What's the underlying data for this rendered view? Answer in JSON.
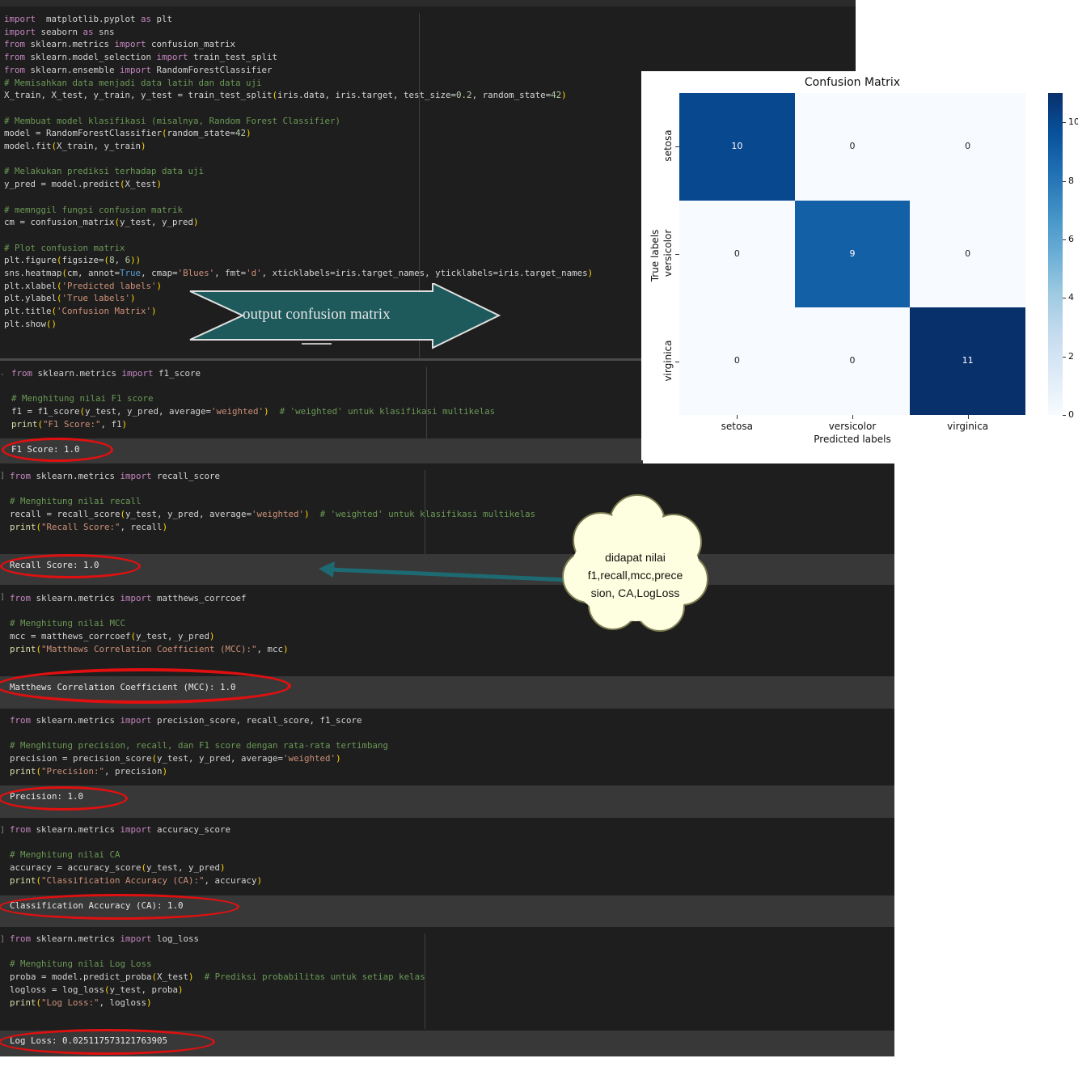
{
  "top_cell": {
    "lines": [
      [
        [
          "kw",
          "import"
        ],
        [
          "",
          "  matplotlib.pyplot "
        ],
        [
          "kw",
          "as"
        ],
        [
          "",
          " plt"
        ]
      ],
      [
        [
          "kw",
          "import"
        ],
        [
          "",
          " seaborn "
        ],
        [
          "kw",
          "as"
        ],
        [
          "",
          " sns"
        ]
      ],
      [
        [
          "kw",
          "from"
        ],
        [
          "",
          " sklearn.metrics "
        ],
        [
          "kw",
          "import"
        ],
        [
          "",
          " confusion_matrix"
        ]
      ],
      [
        [
          "kw",
          "from"
        ],
        [
          "",
          " sklearn.model_selection "
        ],
        [
          "kw",
          "import"
        ],
        [
          "",
          " train_test_split"
        ]
      ],
      [
        [
          "kw",
          "from"
        ],
        [
          "",
          " sklearn.ensemble "
        ],
        [
          "kw",
          "import"
        ],
        [
          "",
          " RandomForestClassifier"
        ]
      ],
      [
        [
          "cm",
          "# Memisahkan data menjadi data latih dan data uji"
        ]
      ],
      [
        [
          "",
          "X_train, X_test, y_train, y_test = train_test_split"
        ],
        [
          "pr",
          "("
        ],
        [
          "",
          "iris.data, iris.target, test_size="
        ],
        [
          "nm",
          "0.2"
        ],
        [
          "",
          ", random_state="
        ],
        [
          "nm",
          "42"
        ],
        [
          "pr",
          ")"
        ]
      ],
      [
        [
          "",
          ""
        ]
      ],
      [
        [
          "cm",
          "# Membuat model klasifikasi (misalnya, Random Forest Classifier)"
        ]
      ],
      [
        [
          "",
          "model = RandomForestClassifier"
        ],
        [
          "pr",
          "("
        ],
        [
          "",
          "random_state="
        ],
        [
          "nm",
          "42"
        ],
        [
          "pr",
          ")"
        ]
      ],
      [
        [
          "",
          "model.fit"
        ],
        [
          "pr",
          "("
        ],
        [
          "",
          "X_train, y_train"
        ],
        [
          "pr",
          ")"
        ]
      ],
      [
        [
          "",
          ""
        ]
      ],
      [
        [
          "cm",
          "# Melakukan prediksi terhadap data uji"
        ]
      ],
      [
        [
          "",
          "y_pred = model.predict"
        ],
        [
          "pr",
          "("
        ],
        [
          "",
          "X_test"
        ],
        [
          "pr",
          ")"
        ]
      ],
      [
        [
          "",
          ""
        ]
      ],
      [
        [
          "cm",
          "# memnggil fungsi confusion matrik"
        ]
      ],
      [
        [
          "",
          "cm = confusion_matrix"
        ],
        [
          "pr",
          "("
        ],
        [
          "",
          "y_test, y_pred"
        ],
        [
          "pr",
          ")"
        ]
      ],
      [
        [
          "",
          ""
        ]
      ],
      [
        [
          "cm",
          "# Plot confusion matrix"
        ]
      ],
      [
        [
          "",
          "plt.figure"
        ],
        [
          "pr",
          "("
        ],
        [
          "",
          "figsize="
        ],
        [
          "pr",
          "("
        ],
        [
          "nm",
          "8"
        ],
        [
          "",
          ", "
        ],
        [
          "nm",
          "6"
        ],
        [
          "pr",
          "))"
        ]
      ],
      [
        [
          "",
          "sns.heatmap"
        ],
        [
          "pr",
          "("
        ],
        [
          "",
          "cm, annot="
        ],
        [
          "bi",
          "True"
        ],
        [
          "",
          ", cmap="
        ],
        [
          "st",
          "'Blues'"
        ],
        [
          "",
          ", fmt="
        ],
        [
          "st",
          "'d'"
        ],
        [
          "",
          ", xticklabels=iris.target_names, yticklabels=iris.target_names"
        ],
        [
          "pr",
          ")"
        ]
      ],
      [
        [
          "",
          "plt.xlabel"
        ],
        [
          "pr",
          "("
        ],
        [
          "st",
          "'Predicted labels'"
        ],
        [
          "pr",
          ")"
        ]
      ],
      [
        [
          "",
          "plt.ylabel"
        ],
        [
          "pr",
          "("
        ],
        [
          "st",
          "'True labels'"
        ],
        [
          "pr",
          ")"
        ]
      ],
      [
        [
          "",
          "plt.title"
        ],
        [
          "pr",
          "("
        ],
        [
          "st",
          "'Confusion Matrix'"
        ],
        [
          "pr",
          ")"
        ]
      ],
      [
        [
          "",
          "plt.show"
        ],
        [
          "pr",
          "()"
        ]
      ]
    ]
  },
  "arrow_label": "output confusion matrix",
  "cells": [
    {
      "code": [
        [
          [
            "kw",
            "from"
          ],
          [
            "",
            " sklearn.metrics "
          ],
          [
            "kw",
            "import"
          ],
          [
            "",
            " f1_score"
          ]
        ],
        [
          [
            "",
            ""
          ]
        ],
        [
          [
            "cm",
            "# Menghitung nilai F1 score"
          ]
        ],
        [
          [
            "",
            "f1 = f1_score"
          ],
          [
            "pr",
            "("
          ],
          [
            "",
            "y_test, y_pred, average="
          ],
          [
            "st",
            "'weighted'"
          ],
          [
            "pr",
            ")"
          ],
          [
            "",
            "  "
          ],
          [
            "cm",
            "# 'weighted' untuk klasifikasi multikelas"
          ]
        ],
        [
          [
            "fn",
            "print"
          ],
          [
            "pr",
            "("
          ],
          [
            "st",
            "\"F1 Score:\""
          ],
          [
            "",
            ", f1"
          ],
          [
            "pr",
            ")"
          ]
        ]
      ],
      "output": "F1 Score: 1.0"
    },
    {
      "code": [
        [
          [
            "kw",
            "from"
          ],
          [
            "",
            " sklearn.metrics "
          ],
          [
            "kw",
            "import"
          ],
          [
            "",
            " recall_score"
          ]
        ],
        [
          [
            "",
            ""
          ]
        ],
        [
          [
            "cm",
            "# Menghitung nilai recall"
          ]
        ],
        [
          [
            "",
            "recall = recall_score"
          ],
          [
            "pr",
            "("
          ],
          [
            "",
            "y_test, y_pred, average="
          ],
          [
            "st",
            "'weighted'"
          ],
          [
            "pr",
            ")"
          ],
          [
            "",
            "  "
          ],
          [
            "cm",
            "# 'weighted' untuk klasifikasi multikelas"
          ]
        ],
        [
          [
            "fn",
            "print"
          ],
          [
            "pr",
            "("
          ],
          [
            "st",
            "\"Recall Score:\""
          ],
          [
            "",
            ", recall"
          ],
          [
            "pr",
            ")"
          ]
        ]
      ],
      "output": "Recall Score: 1.0"
    },
    {
      "code": [
        [
          [
            "kw",
            "from"
          ],
          [
            "",
            " sklearn.metrics "
          ],
          [
            "kw",
            "import"
          ],
          [
            "",
            " matthews_corrcoef"
          ]
        ],
        [
          [
            "",
            ""
          ]
        ],
        [
          [
            "cm",
            "# Menghitung nilai MCC"
          ]
        ],
        [
          [
            "",
            "mcc = matthews_corrcoef"
          ],
          [
            "pr",
            "("
          ],
          [
            "",
            "y_test, y_pred"
          ],
          [
            "pr",
            ")"
          ]
        ],
        [
          [
            "fn",
            "print"
          ],
          [
            "pr",
            "("
          ],
          [
            "st",
            "\"Matthews Correlation Coefficient (MCC):\""
          ],
          [
            "",
            ", mcc"
          ],
          [
            "pr",
            ")"
          ]
        ]
      ],
      "output": "Matthews Correlation Coefficient (MCC): 1.0"
    },
    {
      "code": [
        [
          [
            "kw",
            "from"
          ],
          [
            "",
            " sklearn.metrics "
          ],
          [
            "kw",
            "import"
          ],
          [
            "",
            " precision_score, recall_score, f1_score"
          ]
        ],
        [
          [
            "",
            ""
          ]
        ],
        [
          [
            "cm",
            "# Menghitung precision, recall, dan F1 score dengan rata-rata tertimbang"
          ]
        ],
        [
          [
            "",
            "precision = precision_score"
          ],
          [
            "pr",
            "("
          ],
          [
            "",
            "y_test, y_pred, average="
          ],
          [
            "st",
            "'weighted'"
          ],
          [
            "pr",
            ")"
          ]
        ],
        [
          [
            "fn",
            "print"
          ],
          [
            "pr",
            "("
          ],
          [
            "st",
            "\"Precision:\""
          ],
          [
            "",
            ", precision"
          ],
          [
            "pr",
            ")"
          ]
        ]
      ],
      "output": "Precision: 1.0"
    },
    {
      "code": [
        [
          [
            "kw",
            "from"
          ],
          [
            "",
            " sklearn.metrics "
          ],
          [
            "kw",
            "import"
          ],
          [
            "",
            " accuracy_score"
          ]
        ],
        [
          [
            "",
            ""
          ]
        ],
        [
          [
            "cm",
            "# Menghitung nilai CA"
          ]
        ],
        [
          [
            "",
            "accuracy = accuracy_score"
          ],
          [
            "pr",
            "("
          ],
          [
            "",
            "y_test, y_pred"
          ],
          [
            "pr",
            ")"
          ]
        ],
        [
          [
            "fn",
            "print"
          ],
          [
            "pr",
            "("
          ],
          [
            "st",
            "\"Classification Accuracy (CA):\""
          ],
          [
            "",
            ", accuracy"
          ],
          [
            "pr",
            ")"
          ]
        ]
      ],
      "output": "Classification Accuracy (CA): 1.0"
    },
    {
      "code": [
        [
          [
            "kw",
            "from"
          ],
          [
            "",
            " sklearn.metrics "
          ],
          [
            "kw",
            "import"
          ],
          [
            "",
            " log_loss"
          ]
        ],
        [
          [
            "",
            ""
          ]
        ],
        [
          [
            "cm",
            "# Menghitung nilai Log Loss"
          ]
        ],
        [
          [
            "",
            "proba = model.predict_proba"
          ],
          [
            "pr",
            "("
          ],
          [
            "",
            "X_test"
          ],
          [
            "pr",
            ")"
          ],
          [
            "",
            "  "
          ],
          [
            "cm",
            "# Prediksi probabilitas untuk setiap kelas"
          ]
        ],
        [
          [
            "",
            "logloss = log_loss"
          ],
          [
            "pr",
            "("
          ],
          [
            "",
            "y_test, proba"
          ],
          [
            "pr",
            ")"
          ]
        ],
        [
          [
            "fn",
            "print"
          ],
          [
            "pr",
            "("
          ],
          [
            "st",
            "\"Log Loss:\""
          ],
          [
            "",
            ", logloss"
          ],
          [
            "pr",
            ")"
          ]
        ]
      ],
      "output": "Log Loss: 0.025117573121763905"
    }
  ],
  "cloud": {
    "line1": "didapat nilai",
    "line2": "f1,recall,mcc,prece",
    "line3": "sion, CA,LogLoss"
  },
  "chart_data": {
    "type": "heatmap",
    "title": "Confusion Matrix",
    "xlabel": "Predicted labels",
    "ylabel": "True labels",
    "x_categories": [
      "setosa",
      "versicolor",
      "virginica"
    ],
    "y_categories": [
      "setosa",
      "versicolor",
      "virginica"
    ],
    "values": [
      [
        10,
        0,
        0
      ],
      [
        0,
        9,
        0
      ],
      [
        0,
        0,
        11
      ]
    ],
    "colormap": "Blues",
    "colorbar_ticks": [
      "0",
      "2",
      "4",
      "6",
      "8",
      "10"
    ],
    "colorbar_range": [
      0,
      11
    ]
  }
}
